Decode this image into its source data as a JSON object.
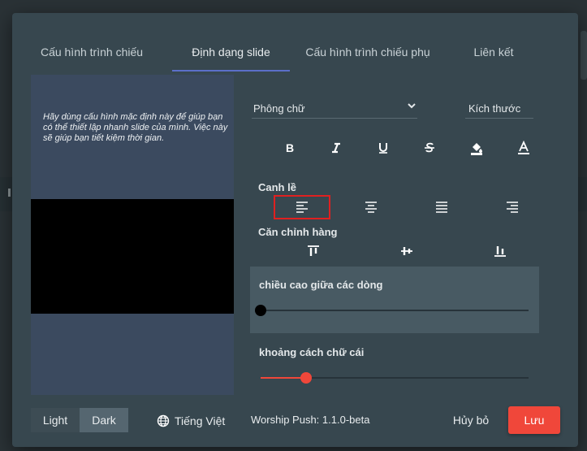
{
  "tabs": [
    {
      "label": "Cấu hình trình chiếu"
    },
    {
      "label": "Định dạng slide"
    },
    {
      "label": "Cấu hình trình chiếu phụ"
    },
    {
      "label": "Liên kết"
    }
  ],
  "preview": {
    "text": "Hãy dùng cấu hình mặc định này để giúp bạn có thể thiết lập nhanh slide của mình. Việc này sẽ giúp bạn tiết kiệm thời gian."
  },
  "font": {
    "label": "Phông chữ",
    "size_label": "Kích thước"
  },
  "format_icons": [
    "bold-icon",
    "italic-icon",
    "underline-icon",
    "strikethrough-icon",
    "fill-color-icon",
    "text-color-icon"
  ],
  "align": {
    "label": "Canh lề",
    "options": [
      "align-left-icon",
      "align-center-icon",
      "align-justify-icon",
      "align-right-icon"
    ],
    "selected": "align-left-icon"
  },
  "valign": {
    "label": "Căn chỉnh hàng",
    "options": [
      "vertical-align-top-icon",
      "vertical-align-center-icon",
      "vertical-align-bottom-icon"
    ]
  },
  "line_height": {
    "label": "chiều cao giữa các dòng",
    "value": 0.0
  },
  "letter_spacing": {
    "label": "khoảng cách chữ cái",
    "value": 0.17
  },
  "footer": {
    "theme_light": "Light",
    "theme_dark": "Dark",
    "theme_selected": "Dark",
    "language": "Tiếng Việt",
    "version": "Worship Push: 1.1.0-beta",
    "cancel": "Hủy bỏ",
    "save": "Lưu"
  },
  "colors": {
    "accent": "#f0473a",
    "tab_indicator": "#5b6fc9",
    "selection_border": "#e02020"
  }
}
